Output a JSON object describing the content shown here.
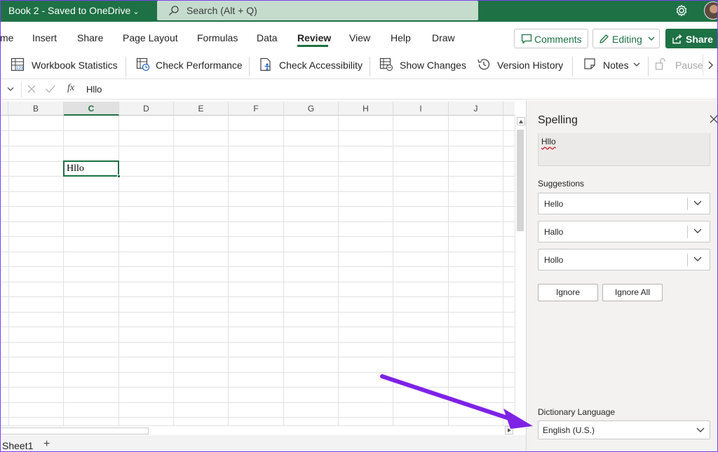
{
  "titlebar": {
    "doc_title": "Book 2 - Saved to OneDrive",
    "search_text": "Search (Alt + Q)"
  },
  "tabs": [
    "me",
    "Insert",
    "Share",
    "Page Layout",
    "Formulas",
    "Data",
    "Review",
    "View",
    "Help",
    "Draw"
  ],
  "active_tab": "Review",
  "ribbon_buttons": {
    "comments": "Comments",
    "editing": "Editing",
    "share": "Share"
  },
  "commands": {
    "workbook_statistics": "Workbook Statistics",
    "check_performance": "Check Performance",
    "check_accessibility": "Check Accessibility",
    "show_changes": "Show Changes",
    "version_history": "Version History",
    "notes": "Notes",
    "pause": "Pause"
  },
  "formula_bar": {
    "fx": "fx",
    "value": "Hllo"
  },
  "grid": {
    "columns": [
      "B",
      "C",
      "D",
      "E",
      "F",
      "G",
      "H",
      "I",
      "J"
    ],
    "active_column": "C",
    "cell_value": "Hllo"
  },
  "sheets": {
    "tab": "Sheet1",
    "add": "+"
  },
  "spelling_pane": {
    "title": "Spelling",
    "not_in_dictionary_word": "Hllo",
    "suggestions_label": "Suggestions",
    "suggestions": [
      "Hello",
      "Hallo",
      "Hollo"
    ],
    "ignore": "Ignore",
    "ignore_all": "Ignore All",
    "dictionary_label": "Dictionary Language",
    "dictionary_value": "English (U.S.)"
  },
  "colors": {
    "brand_green": "#1e7145",
    "annotation_arrow": "#7e22e6"
  }
}
